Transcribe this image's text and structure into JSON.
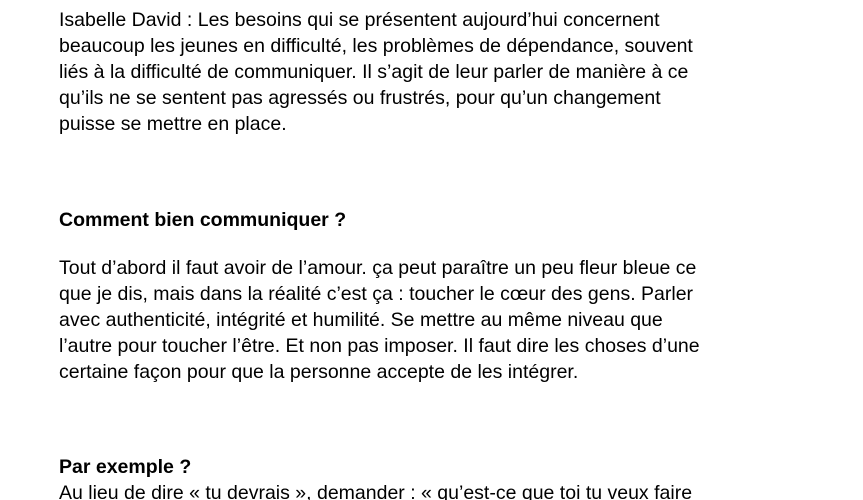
{
  "document": {
    "intro": {
      "lines": [
        "Isabelle David : Les besoins qui se présentent aujourd’hui concernent",
        "beaucoup les jeunes en difficulté, les problèmes de dépendance, souvent",
        "liés à la difficulté de communiquer. Il s’agit de leur parler de manière à ce",
        "qu’ils ne se sentent pas agressés ou frustrés, pour qu’un changement",
        "puisse se mettre en place."
      ]
    },
    "question_1": "Comment bien communiquer ?",
    "answer_1": {
      "lines": [
        "Tout d’abord il faut avoir de l’amour. ça peut paraître un peu fleur bleue ce",
        "que je dis, mais dans la réalité c’est ça : toucher le cœur des gens. Parler",
        "avec authenticité, intégrité et humilité. Se mettre au même niveau que",
        "l’autre pour toucher l’être. Et non pas imposer. Il faut dire les choses d’une",
        "certaine façon pour que la personne accepte de les intégrer."
      ]
    },
    "question_2": "Par exemple ?",
    "answer_2": {
      "lines": [
        "Au lieu de dire « tu devrais », demander : « qu’est-ce que toi tu veux faire"
      ]
    }
  }
}
